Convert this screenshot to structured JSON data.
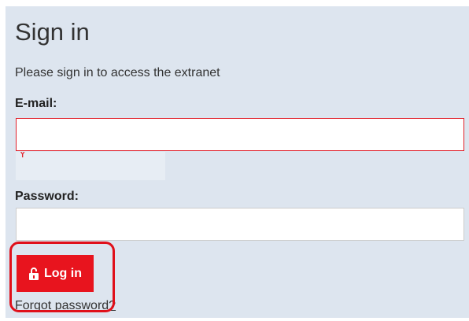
{
  "form": {
    "title": "Sign in",
    "subtitle": "Please sign in to access the extranet",
    "email_label": "E-mail:",
    "email_value": "",
    "email_placeholder": "",
    "email_validation": "Y",
    "password_label": "Password:",
    "password_value": "",
    "password_placeholder": "",
    "login_label": "Log in",
    "forgot_label": "Forgot password?"
  },
  "icons": {
    "login": "unlock-icon"
  },
  "colors": {
    "panel_background": "#dde5ef",
    "error_border": "#e0202a",
    "login_button": "#e8141e",
    "highlight_annotation": "#e0101a"
  }
}
